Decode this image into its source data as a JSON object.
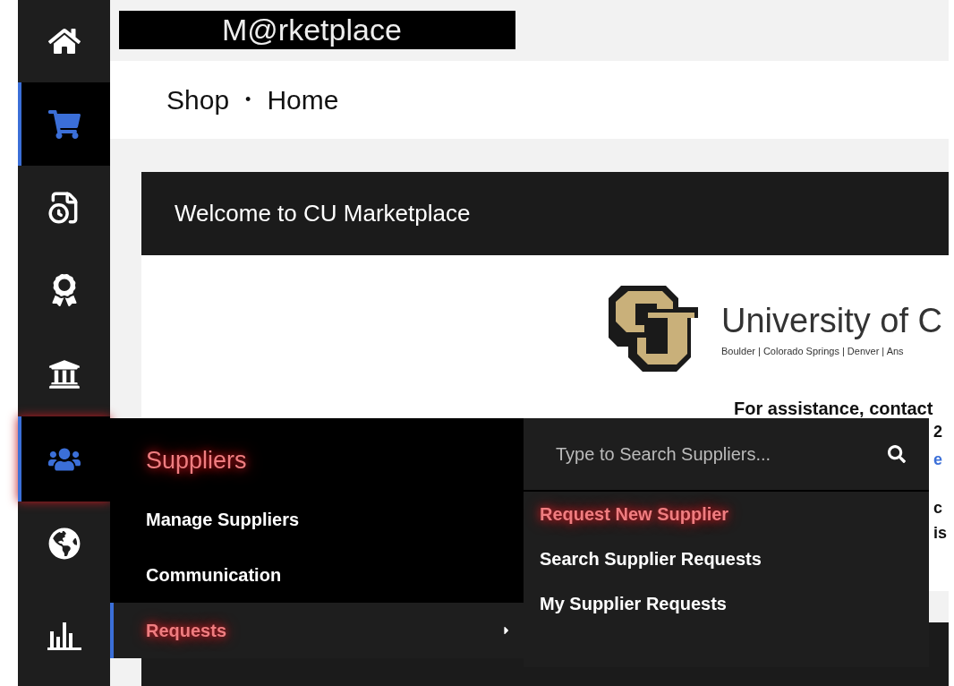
{
  "header": {
    "logo": "M@rketplace"
  },
  "sidebar": {
    "items": [
      {
        "selected": false
      },
      {
        "selected": true
      },
      {
        "selected": false
      },
      {
        "selected": false
      },
      {
        "selected": false
      },
      {
        "selected": true,
        "highlighted": true
      },
      {
        "selected": false
      },
      {
        "selected": false
      }
    ]
  },
  "breadcrumb": {
    "items": [
      "Shop",
      "Home"
    ],
    "separator": "•"
  },
  "card": {
    "title": "Welcome to CU Marketplace",
    "logo_title": "University of C",
    "logo_subtitle": "Boulder | Colorado Springs | Denver | Ans",
    "assistance": "For assistance, contact",
    "fragments": [
      {
        "text": "2",
        "kind": "text"
      },
      {
        "text": "e",
        "kind": "link"
      },
      {
        "text": "c",
        "kind": "text"
      },
      {
        "text": "is",
        "kind": "text"
      }
    ]
  },
  "flyout": {
    "title": "Suppliers",
    "title_highlighted": true,
    "items": [
      {
        "label": "Manage Suppliers",
        "selected": false,
        "highlighted": false,
        "has_submenu": false
      },
      {
        "label": "Communication",
        "selected": false,
        "highlighted": false,
        "has_submenu": false
      },
      {
        "label": "Requests",
        "selected": true,
        "highlighted": true,
        "has_submenu": true
      }
    ],
    "submenu": {
      "search_placeholder": "Type to Search Suppliers...",
      "items": [
        {
          "label": "Request New Supplier",
          "highlighted": true
        },
        {
          "label": "Search Supplier Requests",
          "highlighted": false
        },
        {
          "label": "My Supplier Requests",
          "highlighted": false
        }
      ]
    }
  }
}
